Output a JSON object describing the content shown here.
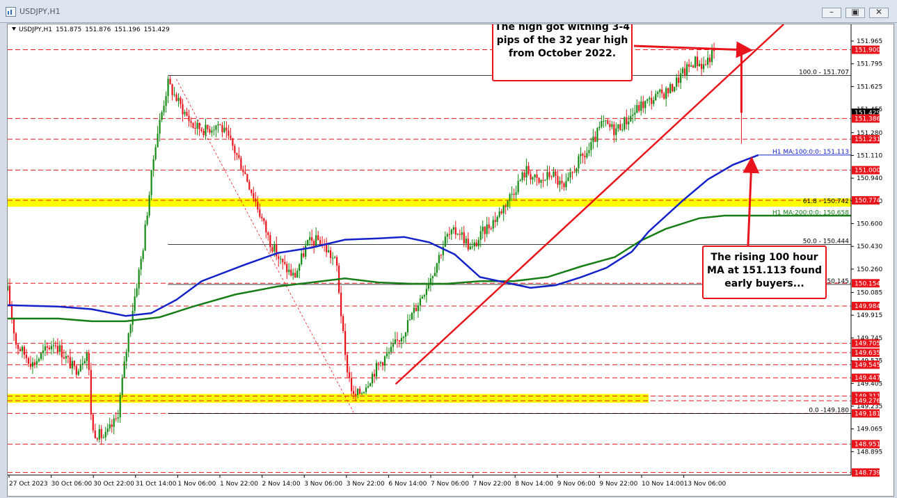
{
  "window": {
    "title": "USDJPY,H1",
    "symbol_line": [
      "USDJPY,H1",
      "151.875",
      "151.876",
      "151.196",
      "151.429"
    ]
  },
  "colors": {
    "bull": "#138a13",
    "bear": "#e8141b",
    "ma100": "#1321c9",
    "ma200": "#177d17",
    "trendline": "#e8141b",
    "highlight": "#ffff00",
    "price_label_bg": "#e8141b"
  },
  "annotations": {
    "top": "The high got withing 3-4 pips of the 32 year high from October 2022.",
    "bottom": "The rising 100 hour MA at 151.113 found early buyers..."
  },
  "chart_data": {
    "type": "candlestick",
    "ylim": [
      148.72,
      152.09
    ],
    "y_ticks": [
      "151.965",
      "151.795",
      "151.625",
      "151.455",
      "151.280",
      "151.110",
      "150.940",
      "150.770",
      "150.600",
      "150.430",
      "150.260",
      "150.085",
      "149.915",
      "149.745",
      "149.575",
      "149.405",
      "149.235",
      "149.065",
      "148.895"
    ],
    "x_ticks": [
      "27 Oct 2023",
      "30 Oct 06:00",
      "30 Oct 22:00",
      "31 Oct 14:00",
      "1 Nov 06:00",
      "1 Nov 22:00",
      "2 Nov 14:00",
      "3 Nov 06:00",
      "3 Nov 22:00",
      "6 Nov 14:00",
      "7 Nov 06:00",
      "7 Nov 22:00",
      "8 Nov 14:00",
      "9 Nov 06:00",
      "9 Nov 22:00",
      "10 Nov 14:00",
      "13 Nov 06:00"
    ],
    "price_labels": [
      {
        "value": 151.9,
        "text": "151.900",
        "style": "red"
      },
      {
        "value": 151.429,
        "text": "151.429",
        "style": "black"
      },
      {
        "value": 151.386,
        "text": "151.386",
        "style": "red"
      },
      {
        "value": 151.231,
        "text": "151.231",
        "style": "red"
      },
      {
        "value": 151.0,
        "text": "151.000",
        "style": "red"
      },
      {
        "value": 150.774,
        "text": "150.774",
        "style": "red"
      },
      {
        "value": 150.154,
        "text": "150.154",
        "style": "red"
      },
      {
        "value": 149.984,
        "text": "149.984",
        "style": "red"
      },
      {
        "value": 149.705,
        "text": "149.705",
        "style": "red"
      },
      {
        "value": 149.635,
        "text": "149.635",
        "style": "red"
      },
      {
        "value": 149.545,
        "text": "149.545",
        "style": "red"
      },
      {
        "value": 149.447,
        "text": "149.447",
        "style": "red"
      },
      {
        "value": 149.311,
        "text": "149.311",
        "style": "red"
      },
      {
        "value": 149.276,
        "text": "149.276",
        "style": "red"
      },
      {
        "value": 149.181,
        "text": "149.181",
        "style": "red"
      },
      {
        "value": 148.951,
        "text": "148.951",
        "style": "red"
      },
      {
        "value": 148.739,
        "text": "148.739",
        "style": "red"
      }
    ],
    "fib_levels": [
      {
        "value": 151.707,
        "text": "100.0 - 151.707"
      },
      {
        "value": 150.742,
        "text": "61.8 - 150.742"
      },
      {
        "value": 150.444,
        "text": "50.0 - 150.444"
      },
      {
        "value": 150.145,
        "text": "2 - 150.145"
      },
      {
        "value": 149.18,
        "text": "0.0 -149.180"
      }
    ],
    "ma_labels": [
      {
        "value": 151.113,
        "text": "H1 MA:100:0:0: 151.113",
        "series": "ma100"
      },
      {
        "value": 150.658,
        "text": "H1 MA:200:0:0: 150.658",
        "series": "ma200"
      }
    ],
    "highlight_zones": [
      {
        "y1": 150.774,
        "y2": 150.742,
        "x_end": 1.0
      },
      {
        "y1": 149.311,
        "y2": 149.276,
        "x_end": 0.76
      }
    ],
    "ma100": [
      [
        0,
        149.99
      ],
      [
        0.06,
        149.98
      ],
      [
        0.1,
        149.96
      ],
      [
        0.14,
        149.91
      ],
      [
        0.17,
        149.93
      ],
      [
        0.2,
        150.03
      ],
      [
        0.23,
        150.17
      ],
      [
        0.28,
        150.29
      ],
      [
        0.32,
        150.38
      ],
      [
        0.36,
        150.42
      ],
      [
        0.4,
        150.48
      ],
      [
        0.44,
        150.49
      ],
      [
        0.47,
        150.5
      ],
      [
        0.5,
        150.46
      ],
      [
        0.53,
        150.37
      ],
      [
        0.56,
        150.2
      ],
      [
        0.59,
        150.16
      ],
      [
        0.62,
        150.12
      ],
      [
        0.65,
        150.14
      ],
      [
        0.68,
        150.2
      ],
      [
        0.71,
        150.27
      ],
      [
        0.74,
        150.39
      ],
      [
        0.76,
        150.54
      ],
      [
        0.8,
        150.77
      ],
      [
        0.83,
        150.93
      ],
      [
        0.86,
        151.04
      ],
      [
        0.89,
        151.113
      ]
    ],
    "ma200": [
      [
        0,
        149.89
      ],
      [
        0.06,
        149.89
      ],
      [
        0.1,
        149.87
      ],
      [
        0.14,
        149.87
      ],
      [
        0.18,
        149.9
      ],
      [
        0.22,
        149.98
      ],
      [
        0.27,
        150.07
      ],
      [
        0.32,
        150.13
      ],
      [
        0.36,
        150.16
      ],
      [
        0.4,
        150.19
      ],
      [
        0.44,
        150.16
      ],
      [
        0.48,
        150.15
      ],
      [
        0.52,
        150.15
      ],
      [
        0.56,
        150.17
      ],
      [
        0.6,
        150.17
      ],
      [
        0.64,
        150.2
      ],
      [
        0.68,
        150.28
      ],
      [
        0.72,
        150.35
      ],
      [
        0.75,
        150.47
      ],
      [
        0.78,
        150.56
      ],
      [
        0.82,
        150.64
      ],
      [
        0.85,
        150.66
      ],
      [
        1.0,
        150.66
      ]
    ],
    "trendline": [
      [
        0.46,
        149.4
      ],
      [
        0.92,
        152.09
      ]
    ],
    "fib_line": [
      [
        0.2,
        151.68
      ],
      [
        0.41,
        149.19
      ]
    ],
    "anchor_lines": [
      {
        "y": 151.707,
        "x1": 0.19,
        "x2": 1.0
      },
      {
        "y": 150.444,
        "x1": 0.19,
        "x2": 1.0
      },
      {
        "y": 150.145,
        "x1": 0.19,
        "x2": 1.0
      },
      {
        "y": 149.18,
        "x1": 0.19,
        "x2": 1.0
      }
    ],
    "waypoints": [
      [
        0,
        150.1
      ],
      [
        0.01,
        149.7
      ],
      [
        0.03,
        149.55
      ],
      [
        0.055,
        149.72
      ],
      [
        0.08,
        149.5
      ],
      [
        0.095,
        149.65
      ],
      [
        0.1,
        149.05
      ],
      [
        0.115,
        149.0
      ],
      [
        0.13,
        149.15
      ],
      [
        0.145,
        149.85
      ],
      [
        0.16,
        150.4
      ],
      [
        0.175,
        151.2
      ],
      [
        0.19,
        151.65
      ],
      [
        0.205,
        151.48
      ],
      [
        0.22,
        151.33
      ],
      [
        0.235,
        151.3
      ],
      [
        0.25,
        151.35
      ],
      [
        0.265,
        151.2
      ],
      [
        0.28,
        151.0
      ],
      [
        0.295,
        150.75
      ],
      [
        0.31,
        150.48
      ],
      [
        0.325,
        150.3
      ],
      [
        0.34,
        150.2
      ],
      [
        0.355,
        150.45
      ],
      [
        0.37,
        150.48
      ],
      [
        0.39,
        150.3
      ],
      [
        0.4,
        149.6
      ],
      [
        0.41,
        149.3
      ],
      [
        0.42,
        149.35
      ],
      [
        0.44,
        149.55
      ],
      [
        0.455,
        149.65
      ],
      [
        0.47,
        149.8
      ],
      [
        0.49,
        150.05
      ],
      [
        0.505,
        150.25
      ],
      [
        0.52,
        150.5
      ],
      [
        0.535,
        150.55
      ],
      [
        0.55,
        150.4
      ],
      [
        0.565,
        150.55
      ],
      [
        0.58,
        150.65
      ],
      [
        0.6,
        150.85
      ],
      [
        0.615,
        151.0
      ],
      [
        0.63,
        150.9
      ],
      [
        0.645,
        150.98
      ],
      [
        0.66,
        150.85
      ],
      [
        0.675,
        151.05
      ],
      [
        0.69,
        151.15
      ],
      [
        0.705,
        151.35
      ],
      [
        0.72,
        151.3
      ],
      [
        0.735,
        151.38
      ],
      [
        0.75,
        151.48
      ],
      [
        0.77,
        151.55
      ],
      [
        0.785,
        151.6
      ],
      [
        0.8,
        151.72
      ],
      [
        0.815,
        151.82
      ],
      [
        0.825,
        151.78
      ],
      [
        0.835,
        151.87
      ],
      [
        0.84,
        151.88
      ]
    ],
    "last_candle": {
      "open": 151.875,
      "high": 151.876,
      "low": 151.196,
      "close": 151.429
    }
  }
}
